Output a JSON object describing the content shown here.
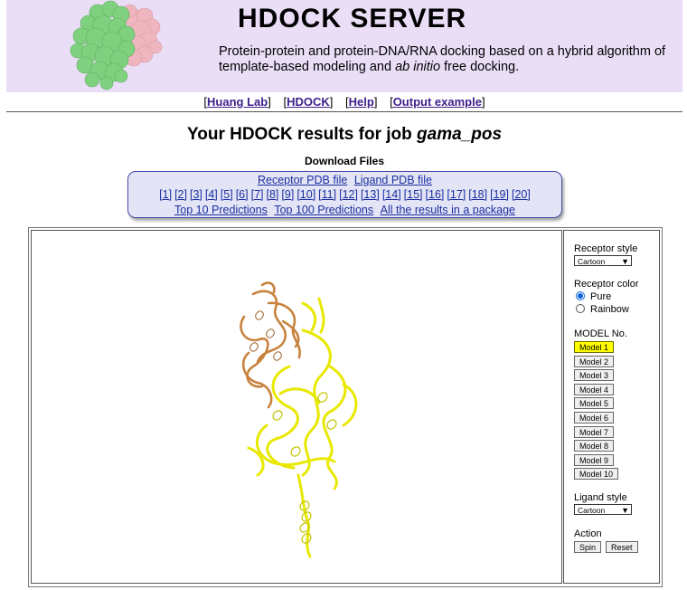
{
  "header": {
    "title": "HDOCK SERVER",
    "description_parts": {
      "before": "Protein-protein and protein-DNA/RNA docking based on a hybrid algorithm of template-based modeling and ",
      "italic": "ab initio",
      "after": " free docking."
    }
  },
  "nav": {
    "items": [
      "Huang Lab",
      "HDOCK",
      "Help",
      "Output example"
    ]
  },
  "results": {
    "title_prefix": "Your HDOCK results for job ",
    "job_name": "gama_pos",
    "download_heading": "Download Files",
    "receptor_link": "Receptor PDB file",
    "ligand_link": "Ligand PDB file",
    "model_links": [
      "[1]",
      "[2]",
      "[3]",
      "[4]",
      "[5]",
      "[6]",
      "[7]",
      "[8]",
      "[9]",
      "[10]",
      "[11]",
      "[12]",
      "[13]",
      "[14]",
      "[15]",
      "[16]",
      "[17]",
      "[18]",
      "[19]",
      "[20]"
    ],
    "top10": "Top 10 Predictions",
    "top100": "Top 100 Predictions",
    "package": "All the results in a package"
  },
  "panel": {
    "receptor_style_label": "Receptor style",
    "receptor_style_value": "Cartoon",
    "receptor_color_label": "Receptor color",
    "color_options": [
      "Pure",
      "Rainbow"
    ],
    "color_selected": "Pure",
    "model_label": "MODEL No.",
    "models": [
      "Model 1",
      "Model 2",
      "Model 3",
      "Model 4",
      "Model 5",
      "Model 6",
      "Model 7",
      "Model 8",
      "Model 9",
      "Model 10"
    ],
    "active_model": "Model 1",
    "ligand_style_label": "Ligand style",
    "ligand_style_value": "Cartoon",
    "action_label": "Action",
    "spin": "Spin",
    "reset": "Reset"
  },
  "colors": {
    "header_bg": "#eadef7",
    "receptor": "#c8823e",
    "ligand": "#ffff00",
    "logo_green": "#7fd17f",
    "logo_pink": "#f0b6bf"
  }
}
